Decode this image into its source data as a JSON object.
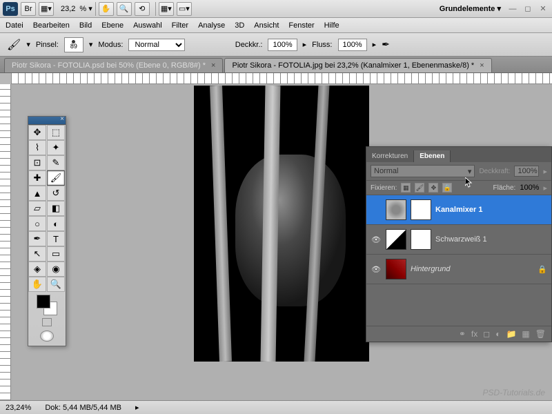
{
  "app": {
    "ps_label": "Ps",
    "br_label": "Br",
    "zoom": "23,2",
    "workspace": "Grundelemente"
  },
  "menu": {
    "datei": "Datei",
    "bearbeiten": "Bearbeiten",
    "bild": "Bild",
    "ebene": "Ebene",
    "auswahl": "Auswahl",
    "filter": "Filter",
    "analyse": "Analyse",
    "d3d": "3D",
    "ansicht": "Ansicht",
    "fenster": "Fenster",
    "hilfe": "Hilfe"
  },
  "options": {
    "pinsel_lbl": "Pinsel:",
    "brush_size": "89",
    "modus_lbl": "Modus:",
    "modus_val": "Normal",
    "deck_lbl": "Deckkr.:",
    "deck_val": "100%",
    "fluss_lbl": "Fluss:",
    "fluss_val": "100%"
  },
  "tabs": {
    "t1": "Piotr Sikora - FOTOLIA.psd bei 50% (Ebene 0, RGB/8#) *",
    "t2": "Piotr Sikora - FOTOLIA.jpg bei 23,2% (Kanalmixer 1, Ebenenmaske/8) *"
  },
  "panel": {
    "tab_korr": "Korrekturen",
    "tab_ebenen": "Ebenen",
    "blend_mode": "Normal",
    "opacity_lbl": "Deckkraft:",
    "opacity_val": "100%",
    "lock_lbl": "Fixieren:",
    "fill_lbl": "Fläche:",
    "fill_val": "100%"
  },
  "layers": {
    "kanalmixer": "Kanalmixer 1",
    "sw": "Schwarzweiß 1",
    "bg": "Hintergrund"
  },
  "status": {
    "zoom": "23,24%",
    "doc": "Dok: 5,44 MB/5,44 MB"
  },
  "watermark": "PSD-Tutorials.de"
}
